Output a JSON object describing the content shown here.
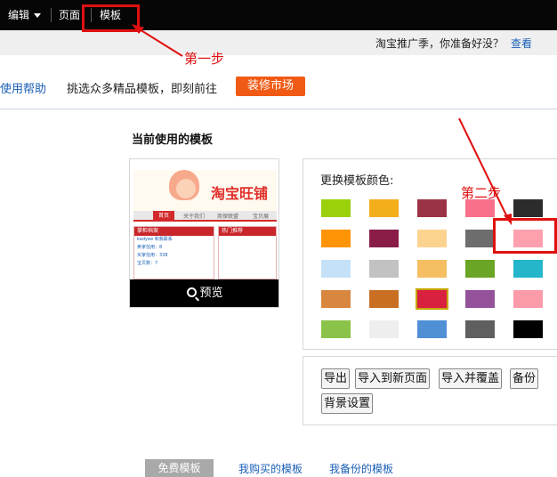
{
  "topbar": {
    "edit": "编辑",
    "page": "页面",
    "template": "模板"
  },
  "subbar": {
    "notice": "淘宝推广季，你准备好没？",
    "view_link": "查看"
  },
  "helprow": {
    "help": "使用帮助",
    "promo": "挑选众多精品模板，即刻前往",
    "market_button": "装修市场"
  },
  "current": {
    "title": "当前使用的模板",
    "thumb": {
      "shop_name": "淘宝旺铺",
      "nav": [
        "首页",
        "关于我们",
        "商保联盟",
        "宝贝展"
      ],
      "side_header": "掌柜档案",
      "side_lines": [
        "kadyee 和我联系",
        "卖家信用：8",
        "买家信用：338",
        "宝贝数：7"
      ],
      "main_header": "热门推荐"
    },
    "preview": "预览"
  },
  "colors": {
    "label": "更换模板颜色:",
    "swatches": [
      [
        "#9bd10a",
        "#f3ae1c",
        "#9b3346",
        "#f8708a",
        "#2c2c2c"
      ],
      [
        "#ff9406",
        "#8a1d47",
        "#fbd38e",
        "#6d6d6d",
        "#ffa0ae"
      ],
      [
        "#c4e1f8",
        "#c2c2c2",
        "#f6be62",
        "#6aa525",
        "#25b6cc"
      ],
      [
        "#d9873f",
        "#c96f24",
        "#d9203f",
        "#93529a",
        "#fb9aa9"
      ],
      [
        "#8bc34a",
        "#eeeeee",
        "#4f8fd6",
        "#5f5f5f",
        "#000000"
      ]
    ]
  },
  "actions": {
    "export": "导出",
    "import_new": "导入到新页面",
    "import_overwrite": "导入并覆盖",
    "backup": "备份",
    "background": "背景设置"
  },
  "tabs": {
    "free": "免费模板",
    "bought": "我购买的模板",
    "backup": "我备份的模板"
  },
  "annotations": {
    "step1": "第一步",
    "step2": "第二步",
    "color": "#e01010"
  }
}
